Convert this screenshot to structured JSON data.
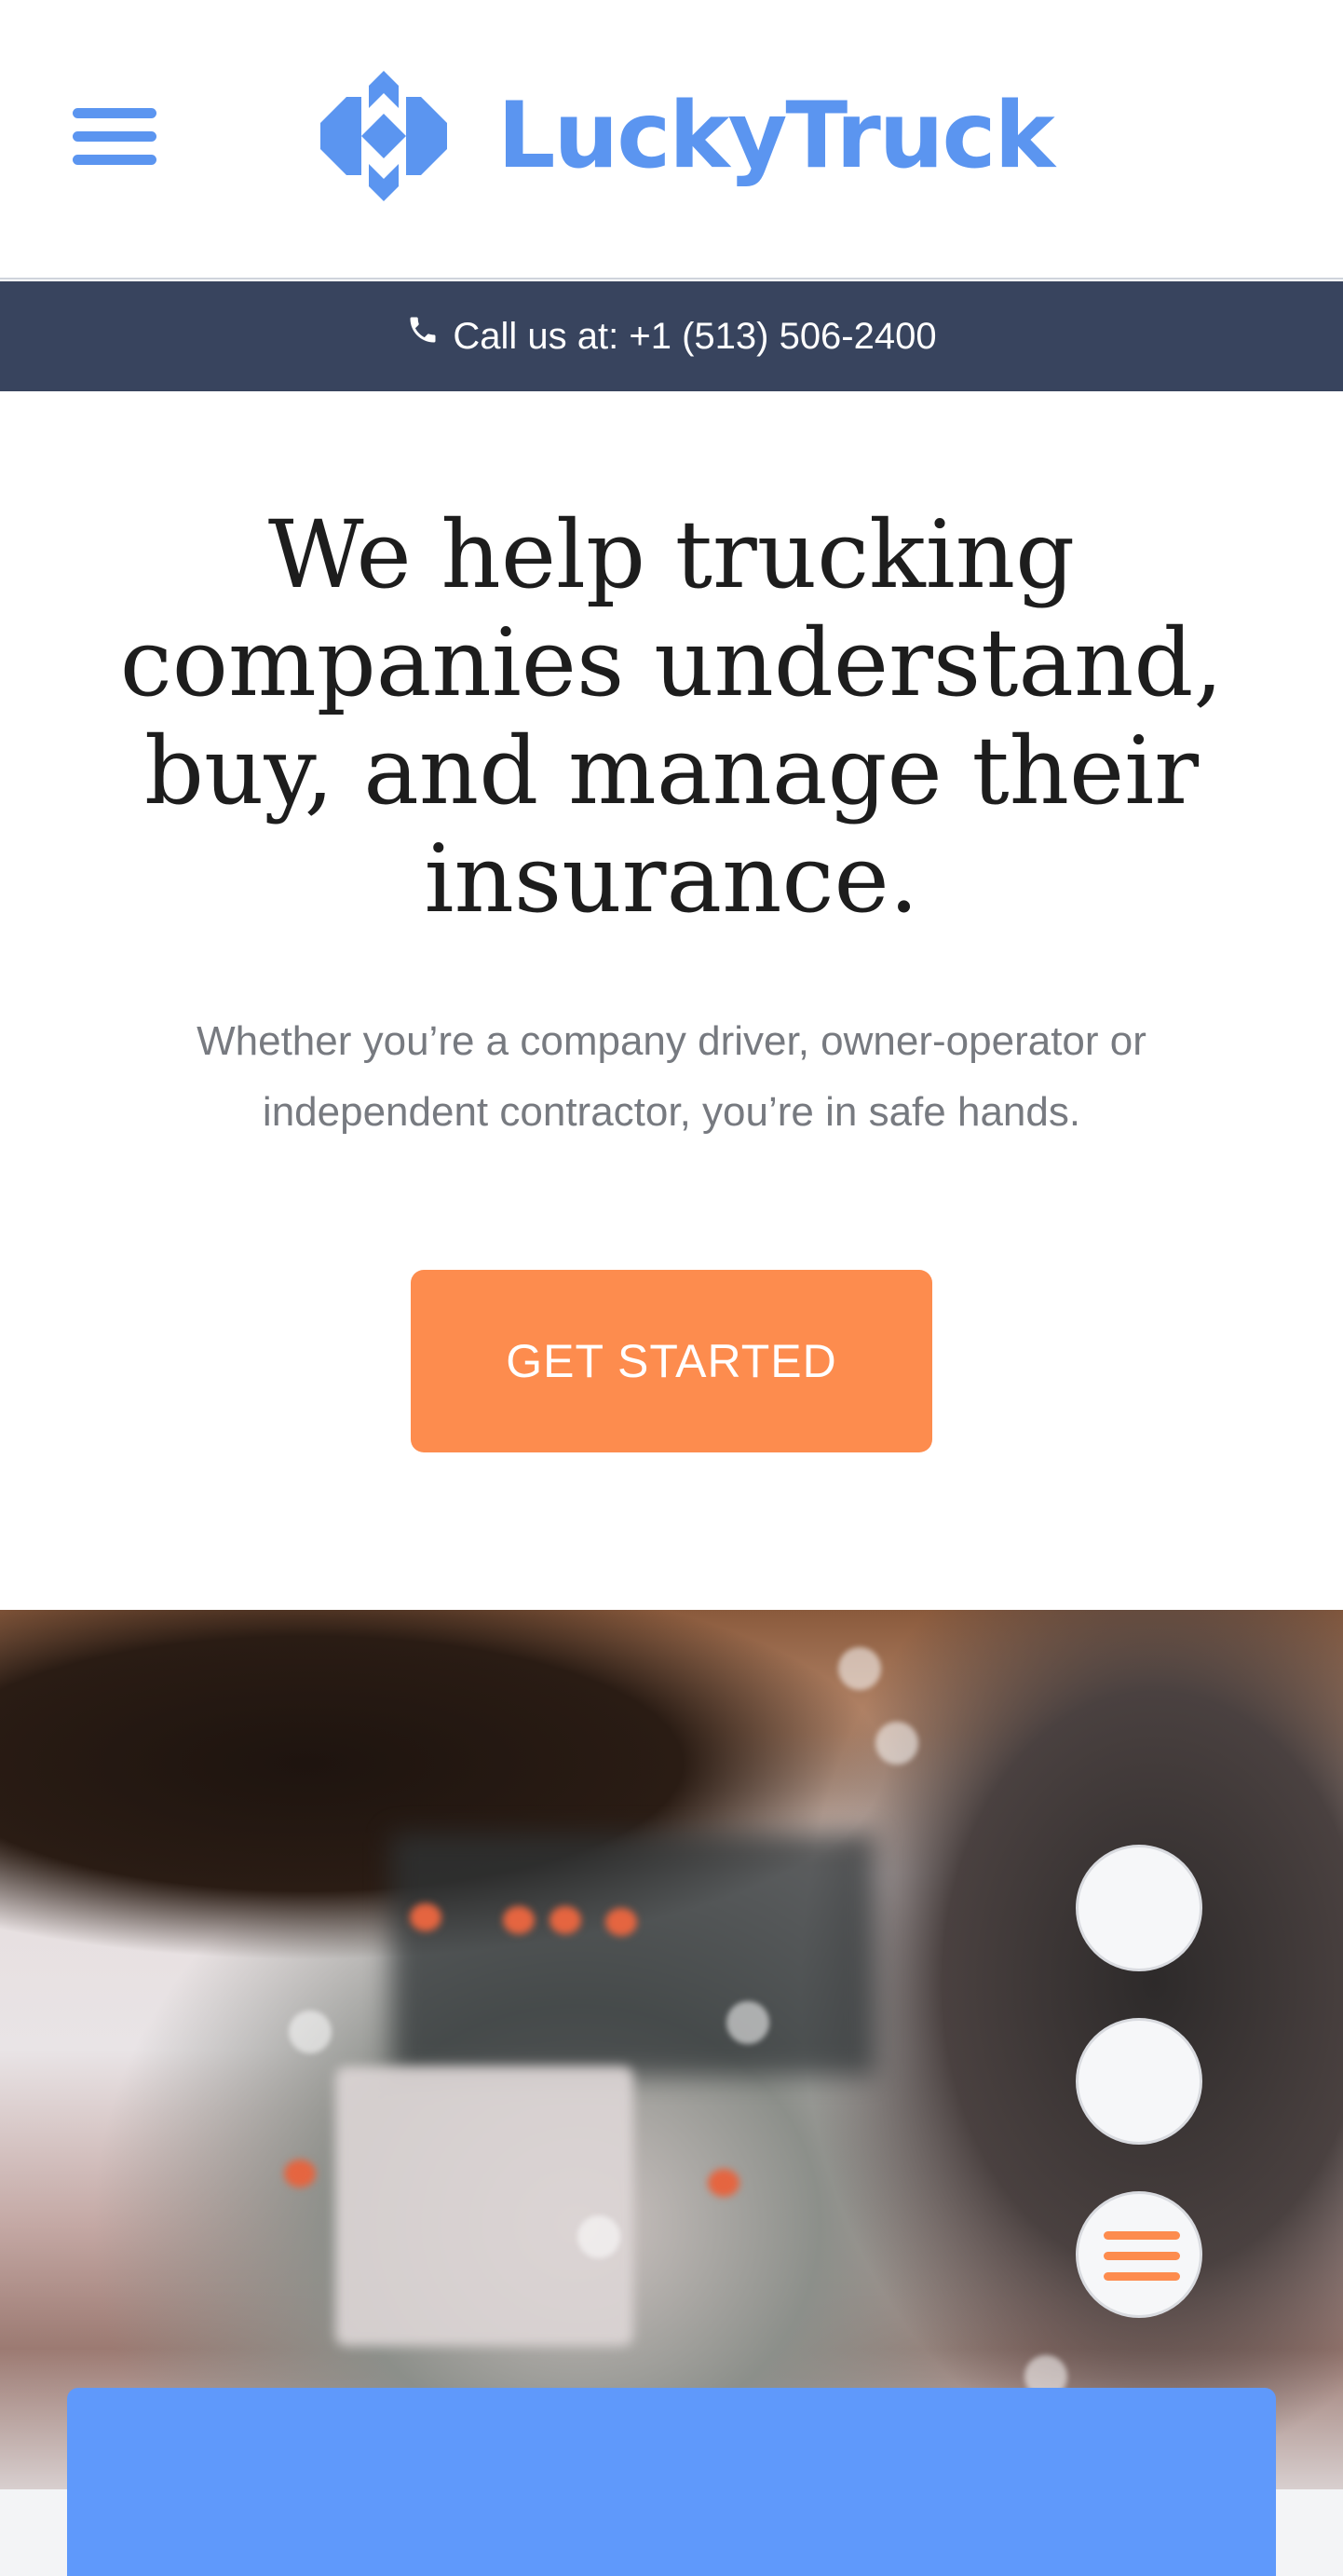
{
  "header": {
    "menu_icon": "hamburger-menu-icon",
    "logo": {
      "text": "LuckyTruck",
      "icon": "luckytruck-diamond-logo-icon",
      "color": "#5b95f0"
    }
  },
  "callbar": {
    "icon": "phone-icon",
    "text": "Call us at: +1 (513) 506-2400",
    "background": "#38445e"
  },
  "hero": {
    "title": "We help trucking companies understand, buy, and manage their insurance.",
    "subtitle": "Whether you’re a company driver, owner-operator or independent contractor, you’re in safe hands.",
    "cta_label": "GET STARTED",
    "cta_color": "#fd8c4e"
  },
  "photo": {
    "icon": "blurred-truck-photo"
  },
  "floating_actions": {
    "items": [
      "blank-circle",
      "blank-circle",
      "hamburger-menu-icon"
    ],
    "accent": "#fd8c4e"
  },
  "bottom_card": {
    "color": "#5f99fb"
  }
}
